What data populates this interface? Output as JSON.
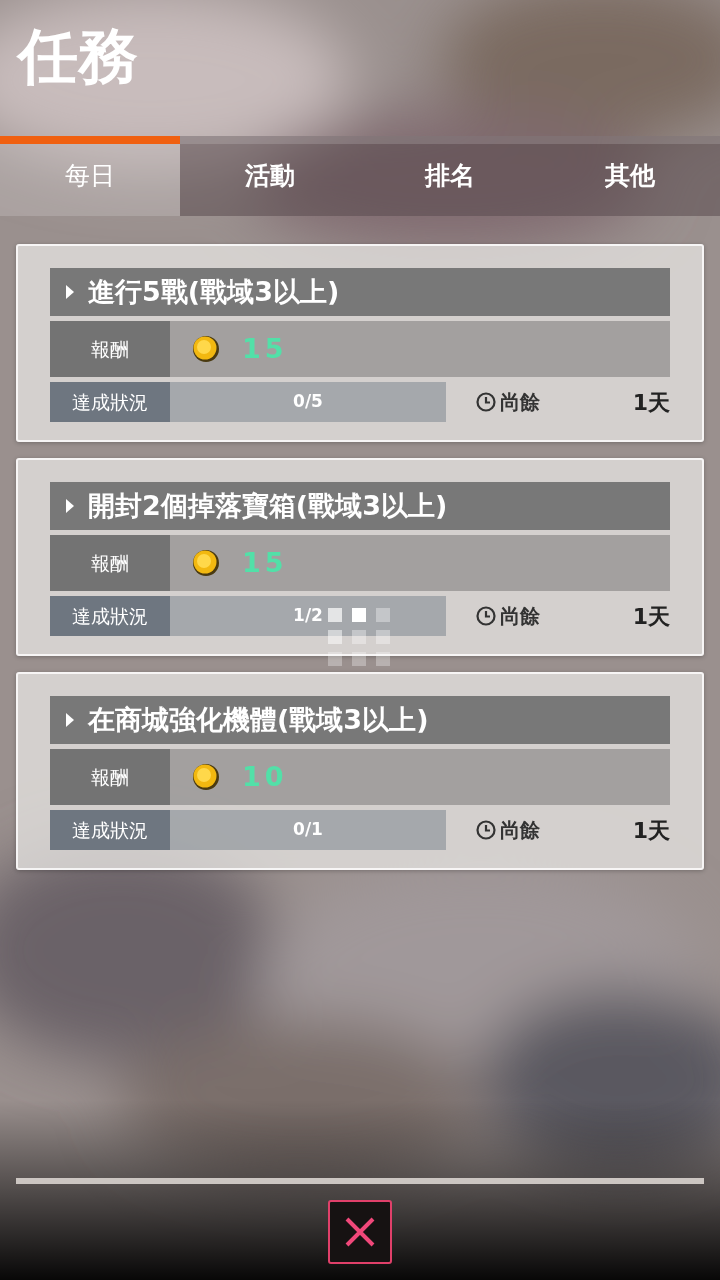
{
  "title": "任務",
  "tabs": [
    {
      "label": "每日",
      "selected": true
    },
    {
      "label": "活動",
      "selected": false
    },
    {
      "label": "排名",
      "selected": false
    },
    {
      "label": "其他",
      "selected": false
    }
  ],
  "missions": [
    {
      "name": "進行5戰(戰域3以上)",
      "reward_label": "報酬",
      "reward": "15",
      "progress_label": "達成狀況",
      "progress": "0/5",
      "remaining_label": "尚餘",
      "remaining": "1天",
      "loading": false
    },
    {
      "name": "開封2個掉落寶箱(戰域3以上)",
      "reward_label": "報酬",
      "reward": "15",
      "progress_label": "達成狀況",
      "progress": "1/2",
      "remaining_label": "尚餘",
      "remaining": "1天",
      "loading": true
    },
    {
      "name": "在商城強化機體(戰域3以上)",
      "reward_label": "報酬",
      "reward": "10",
      "progress_label": "達成狀況",
      "progress": "0/1",
      "remaining_label": "尚餘",
      "remaining": "1天",
      "loading": false
    }
  ]
}
